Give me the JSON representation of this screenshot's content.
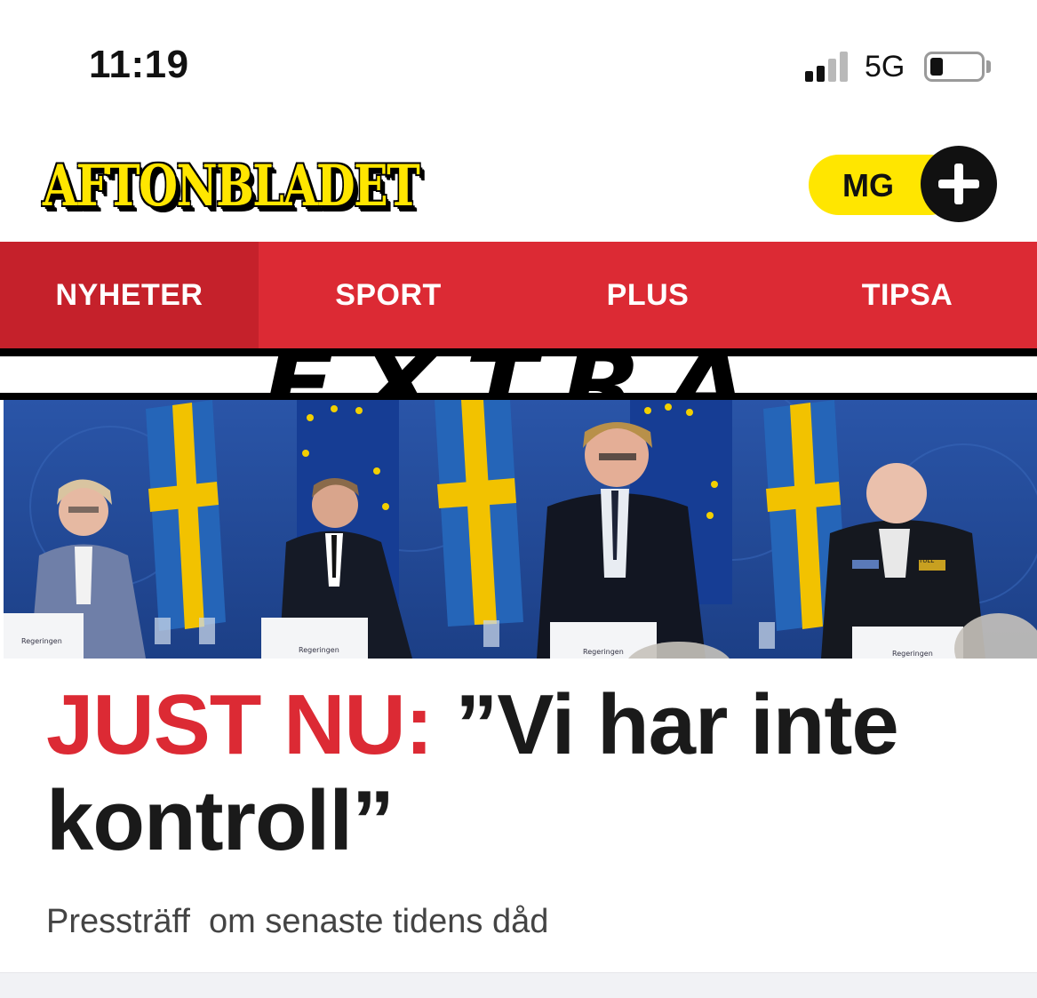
{
  "status_bar": {
    "time": "11:19",
    "network": "5G",
    "signal_icon": "cellular-signal-icon",
    "battery_icon": "battery-low-icon"
  },
  "header": {
    "logo": "AFTONBLADET",
    "logo_colors": {
      "fill": "#ffe600",
      "shadow": "#000000"
    },
    "mg_button": {
      "label": "MG",
      "icon": "plus-icon",
      "color": "#ffe600"
    }
  },
  "nav": {
    "background": "#dc2a34",
    "items": [
      {
        "label": "NYHETER",
        "active": true
      },
      {
        "label": "SPORT",
        "active": false
      },
      {
        "label": "PLUS",
        "active": false
      },
      {
        "label": "TIPSA",
        "active": false
      }
    ]
  },
  "banner": {
    "text": "EXTRA"
  },
  "hero": {
    "podium_labels": [
      "Regeringen",
      "Regeringen",
      "Regeringen",
      "Regeringen"
    ],
    "badge_text": "TULL"
  },
  "article": {
    "kicker": "JUST NU:",
    "title": "”Vi har inte kontroll”",
    "subtitle": "Pressträff  om senaste tidens dåd",
    "kicker_color": "#dc2a34"
  }
}
